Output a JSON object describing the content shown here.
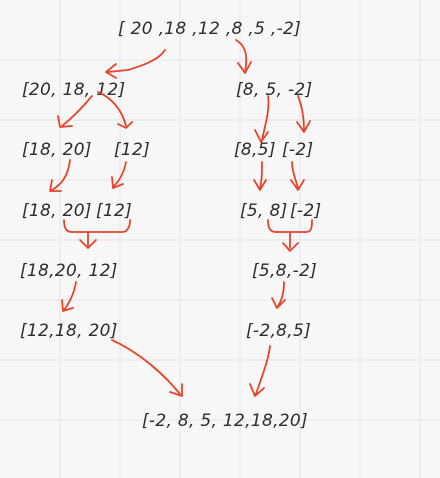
{
  "nodes": {
    "root": "[ 20 ,18  ,12  ,8  ,5  ,-2]",
    "left_split": "[20, 18, 12]",
    "right_split": "[8,  5,  -2]",
    "l_18_20": "[18, 20]",
    "l_12": "[12]",
    "r_8_5": "[8,5]",
    "r_m2": "[-2]",
    "l_pair_18_20": "[18, 20]",
    "l_pair_12": "[12]",
    "r_pair_5_8": "[5, 8]",
    "r_pair_m2": "[-2]",
    "l_merged": "[18,20, 12]",
    "r_merged": "[5,8,-2]",
    "l_sorted": "[12,18, 20]",
    "r_sorted": "[-2,8,5]",
    "final": "[-2, 8, 5, 12,18,20]"
  },
  "colors": {
    "background": "#f7f7f8",
    "grid": "#e6e6e9",
    "text": "#2c2c2c",
    "arrow": "#e8432a"
  }
}
